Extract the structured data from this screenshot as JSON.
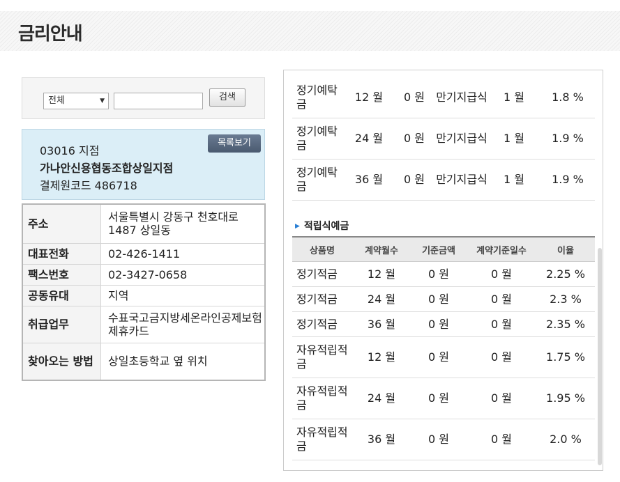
{
  "header": {
    "title": "금리안내"
  },
  "search": {
    "select_value": "전체",
    "input_value": "",
    "button_label": "검색"
  },
  "branch": {
    "code_line": "03016 지점",
    "name": "가나안신용협동조합상일지점",
    "payment_code_line": "결제원코드 486718",
    "list_button_label": "목록보기"
  },
  "info": [
    {
      "label": "주소",
      "value": "서울특별시 강동구 천호대로 1487 상일동"
    },
    {
      "label": "대표전화",
      "value": "02-426-1411"
    },
    {
      "label": "팩스번호",
      "value": "02-3427-0658"
    },
    {
      "label": "공동유대",
      "value": "지역"
    },
    {
      "label": "취급업무",
      "value": "수표국고금지방세온라인공제보험제휴카드"
    },
    {
      "label": "찾아오는 방법",
      "value": "상일초등학교 옆 위치"
    }
  ],
  "deposit_rows": [
    {
      "name": "정기예탁금",
      "months": "12 월",
      "base": "0 원",
      "method": "만기지급식",
      "days": "1 월",
      "rate": "1.8 %"
    },
    {
      "name": "정기예탁금",
      "months": "24 월",
      "base": "0 원",
      "method": "만기지급식",
      "days": "1 월",
      "rate": "1.9 %"
    },
    {
      "name": "정기예탁금",
      "months": "36 월",
      "base": "0 원",
      "method": "만기지급식",
      "days": "1 월",
      "rate": "1.9 %"
    }
  ],
  "installment": {
    "section_title": "적립식예금",
    "headers": [
      "상품명",
      "계약월수",
      "기준금액",
      "계약기준일수",
      "이율"
    ],
    "rows": [
      {
        "name": "정기적금",
        "months": "12 월",
        "base": "0 원",
        "days": "0  월",
        "rate": "2.25 %"
      },
      {
        "name": "정기적금",
        "months": "24 월",
        "base": "0 원",
        "days": "0  월",
        "rate": "2.3 %"
      },
      {
        "name": "정기적금",
        "months": "36 월",
        "base": "0 원",
        "days": "0  월",
        "rate": "2.35 %"
      },
      {
        "name": "자유적립적금",
        "months": "12 월",
        "base": "0 원",
        "days": "0  월",
        "rate": "1.75 %"
      },
      {
        "name": "자유적립적금",
        "months": "24 월",
        "base": "0 원",
        "days": "0  월",
        "rate": "1.95 %"
      },
      {
        "name": "자유적립적금",
        "months": "36 월",
        "base": "0 원",
        "days": "0  월",
        "rate": "2.0 %"
      }
    ]
  }
}
